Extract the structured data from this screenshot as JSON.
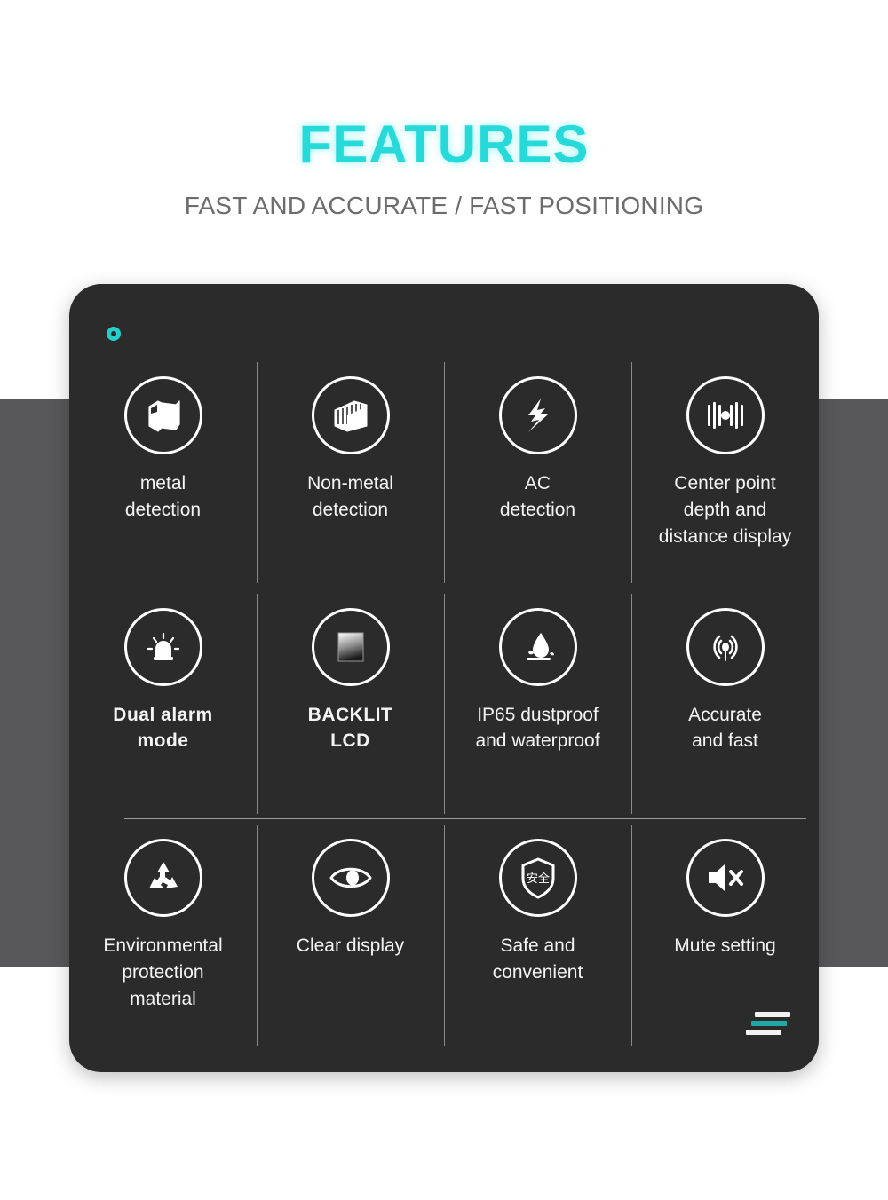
{
  "header": {
    "title": "FEATURES",
    "subtitle": "FAST AND ACCURATE / FAST POSITIONING",
    "title_color": "#28d9d9",
    "subtitle_color": "#6c6c6c"
  },
  "card": {
    "background_color": "#2b2b2b",
    "accent_color": "#25cfcb",
    "corner_ring_icon": "ring-icon",
    "corner_bars_icon": "stacked-bars-icon"
  },
  "background": {
    "page_color": "#ffffff",
    "band_color": "#58585a"
  },
  "features": [
    {
      "icon": "i-beam-metal-icon",
      "label": "metal\ndetection",
      "bold": false
    },
    {
      "icon": "layered-board-icon",
      "label": "Non-metal\ndetection",
      "bold": false
    },
    {
      "icon": "lightning-bolt-icon",
      "label": "AC\ndetection",
      "bold": false
    },
    {
      "icon": "center-point-scale-icon",
      "label": "Center point\ndepth and\ndistance display",
      "bold": false
    },
    {
      "icon": "alarm-siren-icon",
      "label": "Dual alarm\nmode",
      "bold": false
    },
    {
      "icon": "lcd-screen-icon",
      "label": "BACKLIT\nLCD",
      "bold": true
    },
    {
      "icon": "water-drop-splash-icon",
      "label": "IP65 dustproof\nand waterproof",
      "bold": false
    },
    {
      "icon": "radar-target-icon",
      "label": "Accurate\nand fast",
      "bold": false
    },
    {
      "icon": "recycle-icon",
      "label": "Environmental\nprotection\nmaterial",
      "bold": false
    },
    {
      "icon": "eye-icon",
      "label": "Clear display",
      "bold": false
    },
    {
      "icon": "shield-safety-icon",
      "label": "Safe and\nconvenient",
      "bold": false,
      "icon_text": "安全"
    },
    {
      "icon": "mute-speaker-icon",
      "label": "Mute setting",
      "bold": false
    }
  ]
}
